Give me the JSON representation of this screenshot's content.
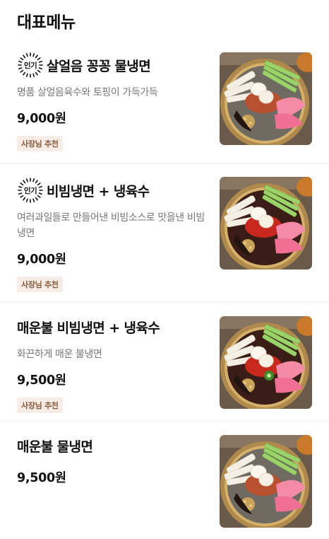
{
  "section": {
    "title": "대표메뉴"
  },
  "popular_label": "인기",
  "items": [
    {
      "name": "살얼음 꽁꽁 물냉면",
      "popular": true,
      "description": "명품 살얼음육수와 토핑이 가득가득",
      "price": "9,000원",
      "badge": "사장님 추천",
      "image": "cold-noodle-broth-photo"
    },
    {
      "name": "비빔냉면 + 냉육수",
      "popular": true,
      "description": "여러과일들로 만들어낸 비빔소스로 맛을낸 비빔냉면",
      "price": "9,000원",
      "badge": "사장님 추천",
      "image": "spicy-mixed-noodle-photo"
    },
    {
      "name": "매운불 비빔냉면 + 냉육수",
      "popular": false,
      "description": "화끈하게 매운 불냉면",
      "price": "9,500원",
      "badge": "사장님 추천",
      "image": "fire-spicy-mixed-noodle-photo"
    },
    {
      "name": "매운불 물냉면",
      "popular": false,
      "description": "",
      "price": "9,500원",
      "badge": "",
      "image": "fire-cold-noodle-broth-photo"
    }
  ]
}
